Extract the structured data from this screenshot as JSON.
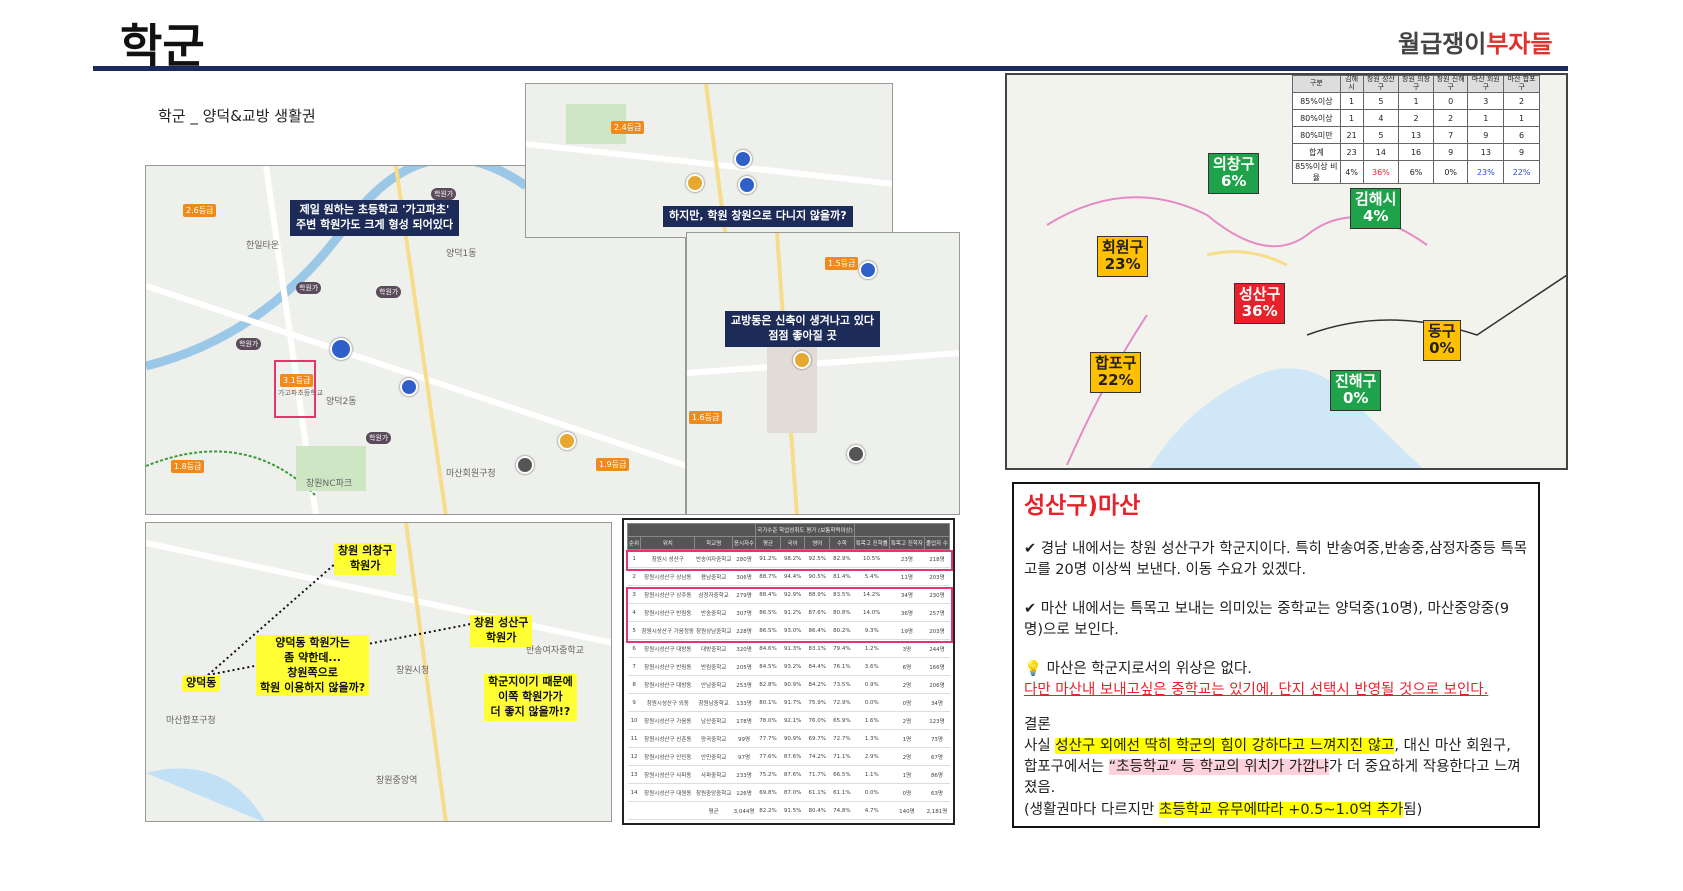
{
  "header": {
    "title": "학군",
    "logo_main": "월급쟁이",
    "logo_accent": "부자들"
  },
  "left": {
    "subtitle": "학군 _ 양덕&교방 생활권",
    "callouts": [
      "제일 원하는 초등학교 '가고파초'\n주변 학원가도 크게 형성 되어있다",
      "하지만, 학원 창원으로 다니지 않을까?",
      "교방동은 신축이 생겨나고 있다\n점점 좋아질 곳"
    ],
    "map_labels": [
      "양덕1동",
      "양덕2동",
      "창원NC파크",
      "마산회원구청",
      "한일타운",
      "3.1등급",
      "가고파초등학교",
      "2.6등급",
      "1.8등급",
      "1.6등급",
      "1.9등급",
      "2.4등급",
      "1.5등급"
    ],
    "academy_tag": "학원가"
  },
  "bottom_map": {
    "labels": [
      "창원 의창구\n학원가",
      "양덕동 학원가는\n좀 약한데...\n창원쪽으로\n학원 이용하지 않을까?",
      "창원 성산구\n학원가",
      "학군지이기 때문에\n이쪽 학원가가\n더 좋지 않을까!?",
      "양덕동"
    ],
    "map_text": [
      "창원시청",
      "반송여자중학교",
      "창원중앙역",
      "마산합포구청"
    ]
  },
  "school_table": {
    "headers": [
      "순위",
      "위치",
      "학교명",
      "응시자수",
      "평균",
      "국어",
      "영어",
      "수학",
      "특목고 진학률",
      "특목고 진학자",
      "졸업자 수"
    ],
    "group_header": "국가수준 학업성취도 평가 (보통학력이상)",
    "rows": [
      [
        "1",
        "창원시 성산구",
        "반송여자중학교",
        "280명",
        "91.2%",
        "98.2%",
        "92.5%",
        "82.9%",
        "10.5%",
        "23명",
        "218명"
      ],
      [
        "2",
        "창원시성산구 상남동",
        "용남중학교",
        "306명",
        "88.7%",
        "94.4%",
        "90.5%",
        "81.4%",
        "5.4%",
        "11명",
        "203명"
      ],
      [
        "3",
        "창원시성산구 상주동",
        "삼정자중학교",
        "279명",
        "88.4%",
        "92.9%",
        "88.9%",
        "83.5%",
        "14.2%",
        "34명",
        "230명"
      ],
      [
        "4",
        "창원시성산구 반림동",
        "반송중학교",
        "307명",
        "86.5%",
        "91.2%",
        "87.6%",
        "80.8%",
        "14.0%",
        "36명",
        "257명"
      ],
      [
        "5",
        "창원시성산구 가음정동",
        "창원상남중학교",
        "228명",
        "86.5%",
        "93.0%",
        "86.4%",
        "80.2%",
        "9.3%",
        "19명",
        "203명"
      ],
      [
        "6",
        "창원시성산구 대방동",
        "대방중학교",
        "320명",
        "84.6%",
        "91.3%",
        "83.1%",
        "79.4%",
        "1.2%",
        "3명",
        "244명"
      ],
      [
        "7",
        "창원시성산구 반림동",
        "반림중학교",
        "205명",
        "84.5%",
        "93.2%",
        "84.4%",
        "76.1%",
        "3.6%",
        "6명",
        "166명"
      ],
      [
        "8",
        "창원시성산구 대방동",
        "안남중학교",
        "253명",
        "82.8%",
        "90.9%",
        "84.2%",
        "73.5%",
        "0.9%",
        "2명",
        "206명"
      ],
      [
        "9",
        "창원시성산구 외동",
        "창원남중학교",
        "133명",
        "80.1%",
        "91.7%",
        "75.9%",
        "72.9%",
        "0.0%",
        "0명",
        "34명"
      ],
      [
        "10",
        "창원시성산구 가음동",
        "남산중학교",
        "178명",
        "78.0%",
        "92.1%",
        "76.0%",
        "65.9%",
        "1.6%",
        "2명",
        "123명"
      ],
      [
        "11",
        "창원시성산구 신촌동",
        "양곡중학교",
        "99명",
        "77.7%",
        "90.9%",
        "69.7%",
        "72.7%",
        "1.3%",
        "1명",
        "73명"
      ],
      [
        "12",
        "창원시성산구 안민동",
        "안민중학교",
        "97명",
        "77.6%",
        "87.6%",
        "74.2%",
        "71.1%",
        "2.9%",
        "2명",
        "67명"
      ],
      [
        "13",
        "창원시성산구 사파동",
        "사파중학교",
        "233명",
        "75.2%",
        "87.6%",
        "71.7%",
        "66.5%",
        "1.1%",
        "1명",
        "86명"
      ],
      [
        "14",
        "창원시성산구 대원동",
        "창원중앙중학교",
        "126명",
        "69.8%",
        "87.0%",
        "61.1%",
        "61.1%",
        "0.0%",
        "0명",
        "63명"
      ]
    ],
    "footer": [
      "",
      "",
      "평균",
      "3,044명",
      "82.2%",
      "91.5%",
      "80.4%",
      "74.8%",
      "4.7%",
      "140명",
      "2,181명"
    ]
  },
  "district_table": {
    "headers": [
      "구분",
      "김해시",
      "창원 성산구",
      "창원 의창구",
      "창원 진해구",
      "마산 회원구",
      "마산 합포구"
    ],
    "rows": [
      [
        "85%이상",
        "1",
        "5",
        "1",
        "0",
        "3",
        "2"
      ],
      [
        "80%이상",
        "1",
        "4",
        "2",
        "2",
        "1",
        "1"
      ],
      [
        "80%미만",
        "21",
        "5",
        "13",
        "7",
        "9",
        "6"
      ],
      [
        "합계",
        "23",
        "14",
        "16",
        "9",
        "13",
        "9"
      ],
      [
        "85%이상 비율",
        "4%",
        "36%",
        "6%",
        "0%",
        "23%",
        "22%"
      ]
    ]
  },
  "districts": [
    {
      "name": "의창구",
      "pct": "6%",
      "color": "green"
    },
    {
      "name": "김해시",
      "pct": "4%",
      "color": "green"
    },
    {
      "name": "회원구",
      "pct": "23%",
      "color": "yellow"
    },
    {
      "name": "성산구",
      "pct": "36%",
      "color": "red"
    },
    {
      "name": "동구",
      "pct": "0%",
      "color": "yellow"
    },
    {
      "name": "합포구",
      "pct": "22%",
      "color": "yellow"
    },
    {
      "name": "진해구",
      "pct": "0%",
      "color": "green"
    }
  ],
  "textbox": {
    "title": "성산구)마산",
    "p1": "경남 내에서는 창원 성산구가 학군지이다. 특히 반송여중,반송중,삼정자중등 특목고를 20명 이상씩 보낸다. 이동 수요가 있겠다.",
    "p2": "마산 내에서는 특목고 보내는 의미있는 중학교는 양덕중(10명), 마산중앙중(9명)으로 보인다.",
    "p3": "마산은 학군지로서의 위상은 없다.",
    "p3_red": "다만 마산내 보내고싶은 중학교는 있기에, 단지 선택시 반영될 것으로 보인다.",
    "c_title": "결론",
    "c1": "사실 ",
    "c1_hl": "성산구 외에선 딱히 학군의 힘이 강하다고 느껴지진 않고",
    "c2": ", 대신 마산 회원구, 합포구에서는 ",
    "c2_hl": "“초등학교“ 등 학교의 위치가 가깝냐",
    "c3": "가 더 중요하게 작용한다고  느껴졌음.",
    "c4": "(생활권마다 다르지만 ",
    "c4_hl": "초등학교 유무에따라 +0.5~1.0억 추가",
    "c5": "됨)"
  }
}
